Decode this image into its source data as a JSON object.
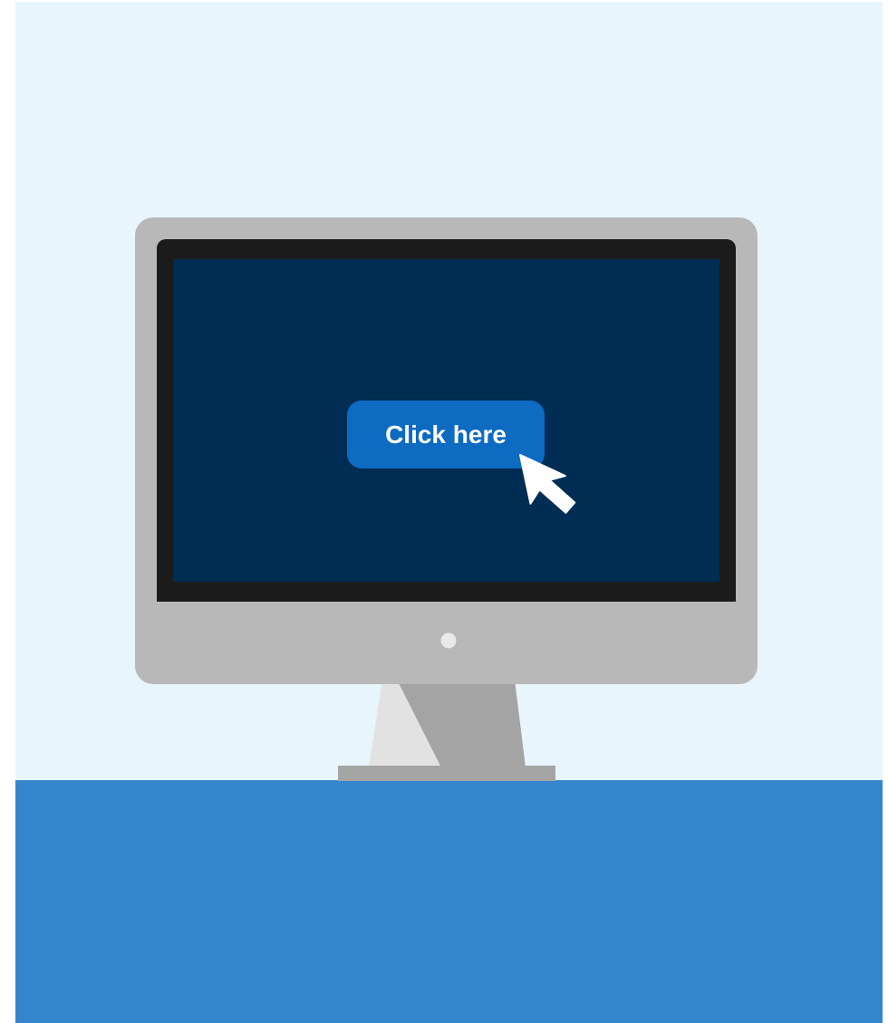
{
  "button": {
    "label": "Click here"
  },
  "icons": {
    "cursor": "mouse-pointer-icon",
    "power": "power-indicator-icon"
  },
  "colors": {
    "wall": "#e8f5fd",
    "desk": "#3585cc",
    "screen": "#002d54",
    "bezel": "#1b1b1b",
    "monitor_body": "#b8b8b8",
    "stand": "#a4a4a4",
    "stand_highlight": "#e2e2e2",
    "button": "#0d6bc2",
    "button_text": "#ffffff"
  }
}
